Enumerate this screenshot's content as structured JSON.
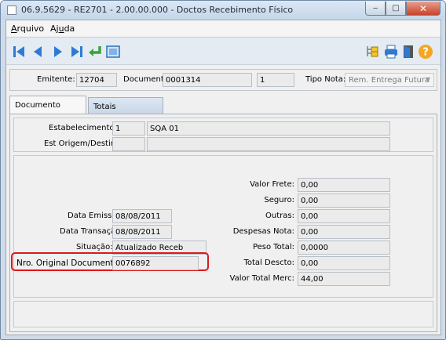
{
  "window": {
    "title": "06.9.5629 - RE2701 - 2.00.00.000 - Doctos Recebimento Físico",
    "controls": {
      "minimize": "‒",
      "maximize": "□",
      "close": "✕"
    }
  },
  "menu": [
    {
      "pre": "",
      "accel": "A",
      "post": "rquivo"
    },
    {
      "pre": "Aj",
      "accel": "u",
      "post": "da"
    }
  ],
  "toolbar": {
    "icons": [
      "first-icon",
      "prev-icon",
      "next-icon",
      "last-icon",
      "goto-icon",
      "zoom-icon",
      "tree-icon",
      "print-icon",
      "exit-icon",
      "help-icon"
    ]
  },
  "header": {
    "emitente_label": "Emitente:",
    "emitente_value": "12704",
    "documento_label": "Documento:",
    "documento_value": "0001314",
    "serie_value": "1",
    "tipo_nota_label": "Tipo Nota:",
    "tipo_nota_value": "Rem. Entrega Futura"
  },
  "tabs": [
    {
      "label": "Documento",
      "active": true
    },
    {
      "label": "Totais",
      "active": false
    }
  ],
  "documento": {
    "estabelecimento_label": "Estabelecimento:",
    "estabelecimento_code": "1",
    "estabelecimento_name": "SQA 01",
    "est_origem_label": "Est Origem/Destino:",
    "est_origem_code": "",
    "est_origem_name": "",
    "data_emissao_label": "Data Emissão:",
    "data_emissao_value": "08/08/2011",
    "data_transacao_label": "Data Transação:",
    "data_transacao_value": "08/08/2011",
    "situacao_label": "Situação:",
    "situacao_value": "Atualizado Receb",
    "nro_original_label": "Nro. Original Documento:",
    "nro_original_value": "0076892"
  },
  "totais": {
    "valor_frete_label": "Valor Frete:",
    "valor_frete_value": "0,00",
    "seguro_label": "Seguro:",
    "seguro_value": "0,00",
    "outras_label": "Outras:",
    "outras_value": "0,00",
    "despesas_label": "Despesas Nota:",
    "despesas_value": "0,00",
    "peso_label": "Peso Total:",
    "peso_value": "0,0000",
    "total_descto_label": "Total Descto:",
    "total_descto_value": "0,00",
    "valor_total_label": "Valor Total Merc:",
    "valor_total_value": "44,00"
  },
  "colors": {
    "highlight": "#e0161b",
    "accent": "#2e7bd6"
  }
}
